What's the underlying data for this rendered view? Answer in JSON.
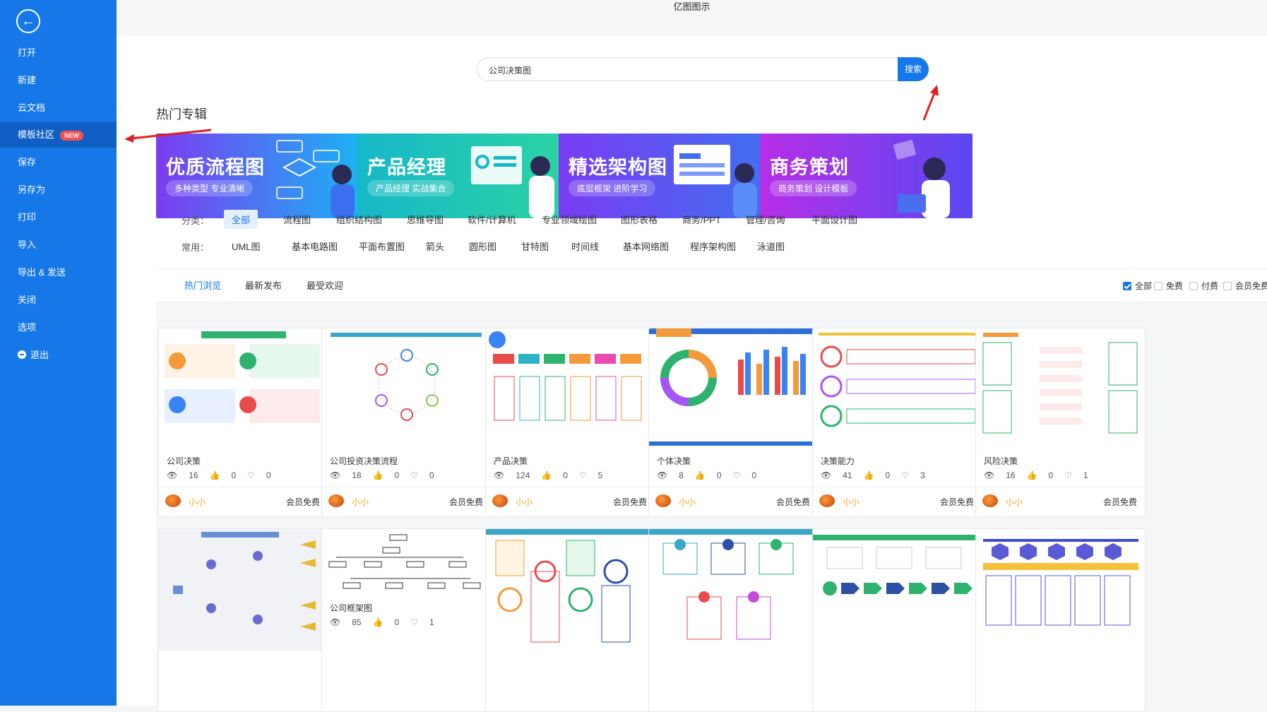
{
  "app": {
    "title": "亿图图示"
  },
  "sidebar": {
    "items": [
      {
        "label": "打开"
      },
      {
        "label": "新建"
      },
      {
        "label": "云文档"
      },
      {
        "label": "模板社区",
        "badge": "NEW"
      },
      {
        "label": "保存"
      },
      {
        "label": "另存为"
      },
      {
        "label": "打印"
      },
      {
        "label": "导入"
      },
      {
        "label": "导出 & 发送"
      },
      {
        "label": "关闭"
      },
      {
        "label": "选项"
      },
      {
        "label": "退出"
      }
    ]
  },
  "search": {
    "value": "公司决策图",
    "button": "搜索"
  },
  "hot": {
    "title": "热门专辑"
  },
  "banners": [
    {
      "title": "优质流程图",
      "subtitle": "多种类型 专业清晰",
      "color_from": "#7b3cf0",
      "color_to": "#17b7f5"
    },
    {
      "title": "产品经理",
      "subtitle": "产品经理 实战集合",
      "color_from": "#16b8c8",
      "color_to": "#2dd4a3"
    },
    {
      "title": "精选架构图",
      "subtitle": "底层框架 进阶学习",
      "color_from": "#7a3cf2",
      "color_to": "#3f6ff0"
    },
    {
      "title": "商务策划",
      "subtitle": "商务策划 设计模板",
      "color_from": "#b62ee8",
      "color_to": "#5a48f0"
    }
  ],
  "filters": {
    "category_label": "分类：",
    "categories": [
      "全部",
      "流程图",
      "组织结构图",
      "思维导图",
      "软件/计算机",
      "专业领域绘图",
      "图形表格",
      "商务/PPT",
      "管理/咨询",
      "平面设计图"
    ],
    "common_label": "常用：",
    "common": [
      "UML图",
      "基本电路图",
      "平面布置图",
      "箭头",
      "圆形图",
      "甘特图",
      "时间线",
      "基本网络图",
      "程序架构图",
      "泳道图"
    ]
  },
  "tabs": [
    "热门浏览",
    "最新发布",
    "最受欢迎"
  ],
  "price_filters": [
    {
      "label": "全部",
      "checked": true
    },
    {
      "label": "免费",
      "checked": false
    },
    {
      "label": "付费",
      "checked": false
    },
    {
      "label": "会员免费",
      "checked": false
    }
  ],
  "cards": [
    {
      "name": "公司决策",
      "views": "16",
      "likes": "0",
      "favs": "0",
      "author": "小小",
      "badge": "会员免费"
    },
    {
      "name": "公司投资决策流程",
      "views": "18",
      "likes": "0",
      "favs": "0",
      "author": "小小",
      "badge": "会员免费"
    },
    {
      "name": "产品决策",
      "views": "124",
      "likes": "0",
      "favs": "5",
      "author": "小小",
      "badge": "会员免费"
    },
    {
      "name": "个体决策",
      "views": "8",
      "likes": "0",
      "favs": "0",
      "author": "小小",
      "badge": "会员免费"
    },
    {
      "name": "决策能力",
      "views": "41",
      "likes": "0",
      "favs": "3",
      "author": "小小",
      "badge": "会员免费"
    },
    {
      "name": "风险决策",
      "views": "16",
      "likes": "0",
      "favs": "1",
      "author": "小小",
      "badge": "会员免费"
    },
    {
      "name": "公司框架图",
      "views": "85",
      "likes": "0",
      "favs": "1"
    }
  ],
  "colors": {
    "accent": "#1677e8",
    "sidebar": "#1677e8",
    "arrow": "#e02020",
    "author": "#f5a623"
  }
}
